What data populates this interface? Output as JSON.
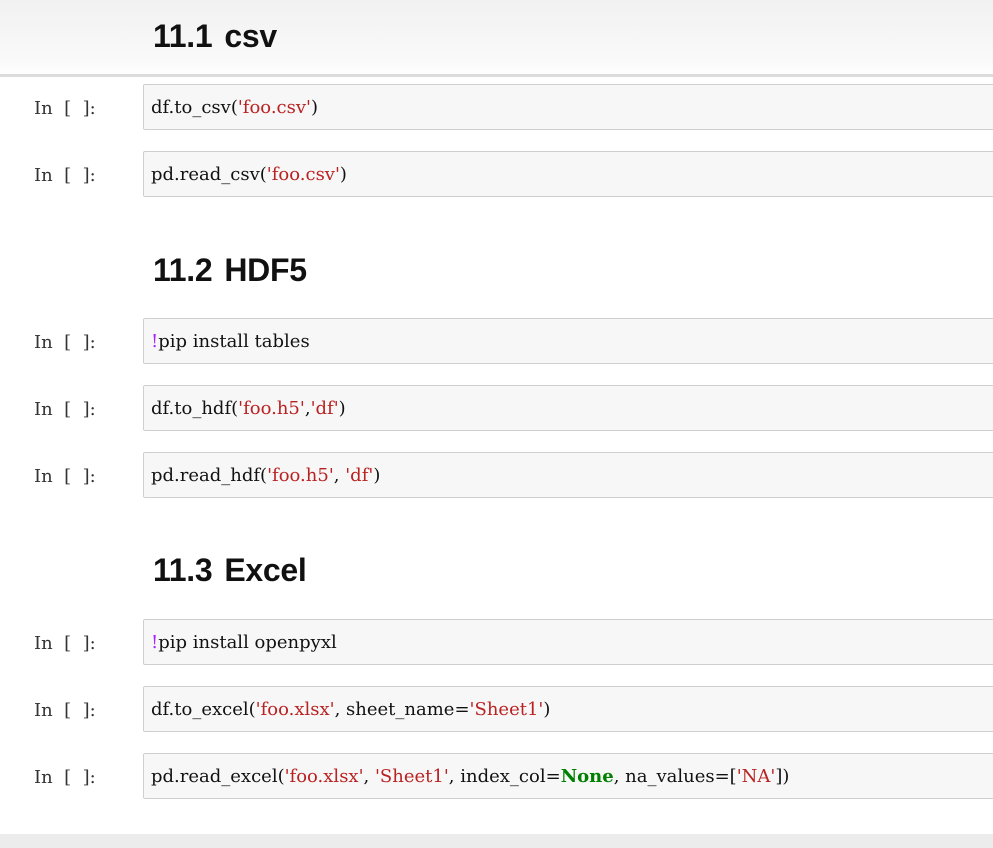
{
  "sections": [
    {
      "number": "11.1",
      "title": "csv",
      "cells": [
        {
          "prompt": "In  [  ]:",
          "tokens": [
            [
              "df.to_csv(",
              "t"
            ],
            [
              "'foo.csv'",
              "s"
            ],
            [
              ")",
              "t"
            ]
          ]
        },
        {
          "prompt": "In  [  ]:",
          "tokens": [
            [
              "pd.read_csv(",
              "t"
            ],
            [
              "'foo.csv'",
              "s"
            ],
            [
              ")",
              "t"
            ]
          ]
        }
      ]
    },
    {
      "number": "11.2",
      "title": "HDF5",
      "cells": [
        {
          "prompt": "In  [  ]:",
          "tokens": [
            [
              "!",
              "b"
            ],
            [
              "pip install tables",
              "t"
            ]
          ]
        },
        {
          "prompt": "In  [  ]:",
          "tokens": [
            [
              "df.to_hdf(",
              "t"
            ],
            [
              "'foo.h5'",
              "s"
            ],
            [
              ",",
              "t"
            ],
            [
              "'df'",
              "s"
            ],
            [
              ")",
              "t"
            ]
          ]
        },
        {
          "prompt": "In  [  ]:",
          "tokens": [
            [
              "pd.read_hdf(",
              "t"
            ],
            [
              "'foo.h5'",
              "s"
            ],
            [
              ", ",
              "t"
            ],
            [
              "'df'",
              "s"
            ],
            [
              ")",
              "t"
            ]
          ]
        }
      ]
    },
    {
      "number": "11.3",
      "title": "Excel",
      "cells": [
        {
          "prompt": "In  [  ]:",
          "tokens": [
            [
              "!",
              "b"
            ],
            [
              "pip install openpyxl",
              "t"
            ]
          ]
        },
        {
          "prompt": "In  [  ]:",
          "tokens": [
            [
              "df.to_excel(",
              "t"
            ],
            [
              "'foo.xlsx'",
              "s"
            ],
            [
              ", sheet_name=",
              "t"
            ],
            [
              "'Sheet1'",
              "s"
            ],
            [
              ")",
              "t"
            ]
          ]
        },
        {
          "prompt": "In  [  ]:",
          "tokens": [
            [
              "pd.read_excel(",
              "t"
            ],
            [
              "'foo.xlsx'",
              "s"
            ],
            [
              ", ",
              "t"
            ],
            [
              "'Sheet1'",
              "s"
            ],
            [
              ", index_col=",
              "t"
            ],
            [
              "None",
              "k"
            ],
            [
              ", na_values=[",
              "t"
            ],
            [
              "'NA'",
              "s"
            ],
            [
              "])",
              "t"
            ]
          ]
        }
      ]
    }
  ]
}
